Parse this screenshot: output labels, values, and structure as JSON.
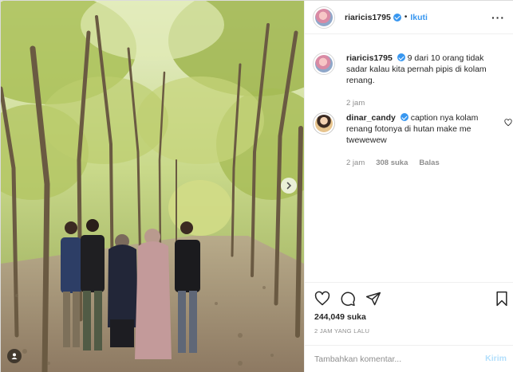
{
  "header": {
    "username": "riaricis1795",
    "separator": "•",
    "follow_label": "Ikuti",
    "more_icon": "more-horizontal-icon"
  },
  "caption": {
    "username": "riaricis1795",
    "text": "9 dari 10 orang tidak sadar kalau kita pernah pipis di kolam renang.",
    "time": "2 jam"
  },
  "comments": [
    {
      "username": "dinar_candy",
      "text": "caption nya kolam renang fotonya di hutan make me twewewew",
      "time": "2 jam",
      "likes": "308 suka",
      "reply_label": "Balas"
    }
  ],
  "actions": {
    "like_icon": "heart-icon",
    "comment_icon": "comment-icon",
    "share_icon": "share-icon",
    "save_icon": "bookmark-icon",
    "likes_count": "244,049 suka",
    "timestamp": "2 JAM YANG LALU"
  },
  "add_comment": {
    "placeholder": "Tambahkan komentar...",
    "post_label": "Kirim"
  },
  "colors": {
    "accent": "#3897f0",
    "verified": "#3897f0",
    "muted": "#8e8e8e",
    "post_disabled": "#b2dffc"
  }
}
